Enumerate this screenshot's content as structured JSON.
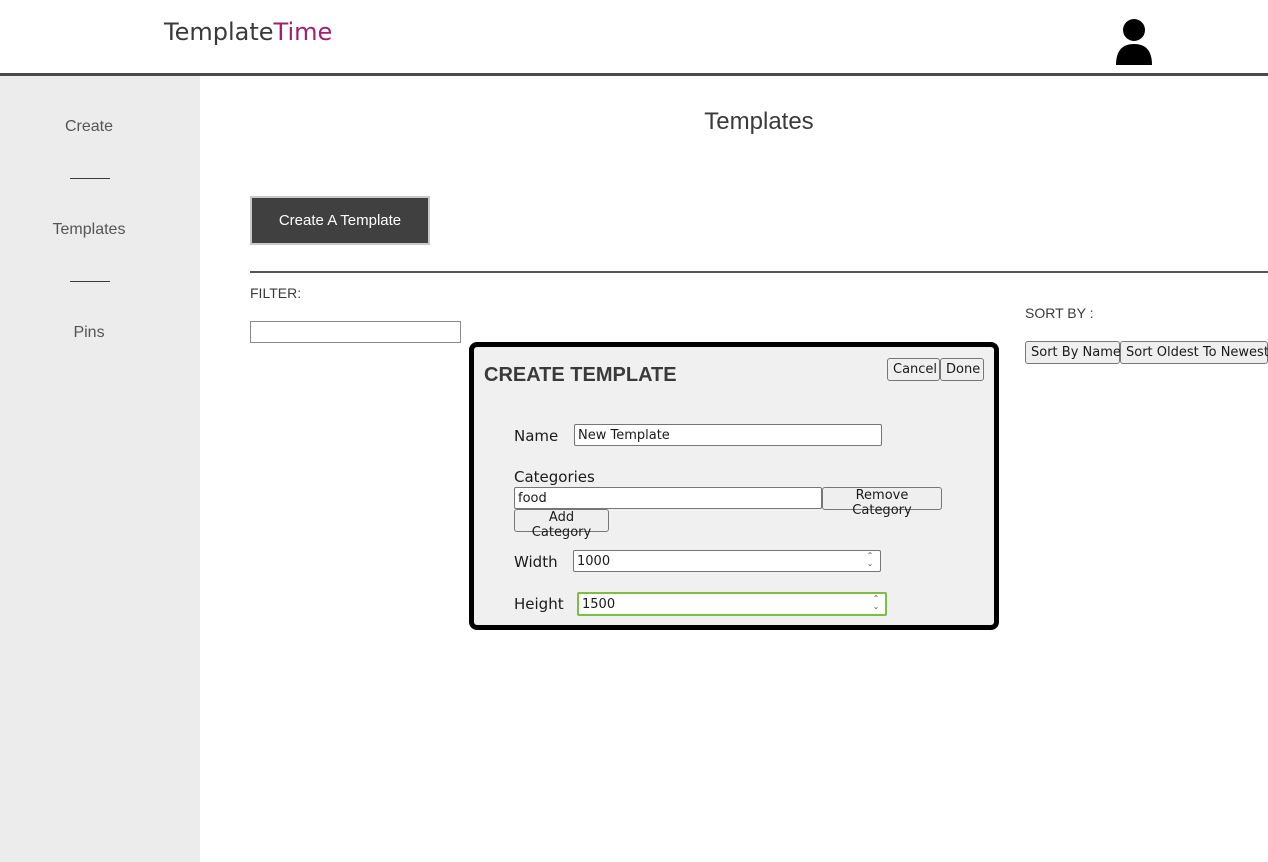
{
  "header": {
    "logo_part1": "Template",
    "logo_part2": "Time",
    "accent_color": "#a0206f",
    "avatar_icon": "user-icon"
  },
  "sidebar": {
    "items": [
      {
        "label": "Create"
      },
      {
        "label": "Templates"
      },
      {
        "label": "Pins"
      }
    ]
  },
  "main": {
    "title": "Templates",
    "create_button": "Create A Template",
    "filter_label": "FILTER:",
    "filter_value": "",
    "sort_label": "SORT BY :",
    "sort_by_name": "Sort By Name",
    "sort_oldest": "Sort Oldest To Newest"
  },
  "modal": {
    "title": "CREATE TEMPLATE",
    "cancel": "Cancel",
    "done": "Done",
    "name_label": "Name",
    "name_value": "New Template",
    "categories_label": "Categories",
    "category_value": "food",
    "remove_category": "Remove Category",
    "add_category": "Add Category",
    "width_label": "Width",
    "width_value": "1000",
    "height_label": "Height",
    "height_value": "1500"
  }
}
